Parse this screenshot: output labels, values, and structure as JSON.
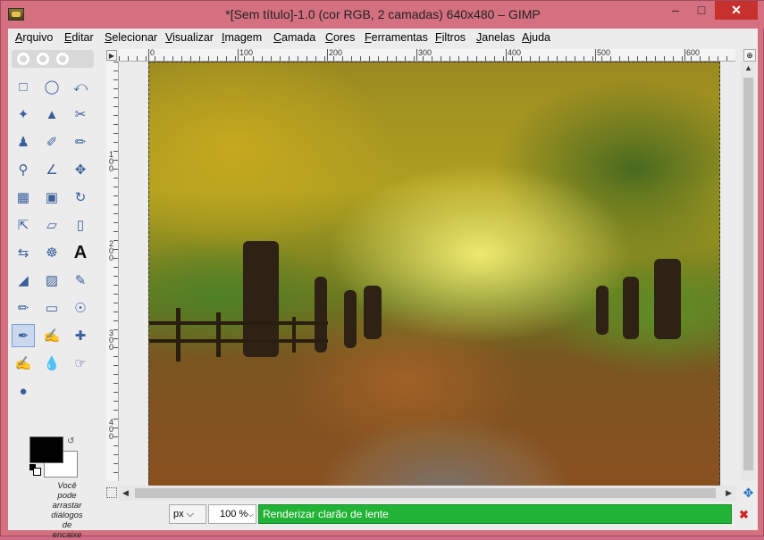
{
  "window": {
    "title": "*[Sem título]-1.0 (cor RGB, 2 camadas) 640x480 – GIMP"
  },
  "menu": [
    "Arquivo",
    "Editar",
    "Selecionar",
    "Visualizar",
    "Imagem",
    "Camada",
    "Cores",
    "Ferramentas",
    "Filtros",
    "Janelas",
    "Ajuda"
  ],
  "toolbox": {
    "tools": [
      "rect-select-icon",
      "ellipse-select-icon",
      "free-select-icon",
      "fuzzy-select-icon",
      "select-by-color-icon",
      "scissors-icon",
      "foreground-select-icon",
      "paths-icon",
      "color-picker-icon",
      "zoom-icon",
      "measure-icon",
      "move-icon",
      "align-icon",
      "crop-icon",
      "rotate-icon",
      "scale-icon",
      "shear-icon",
      "perspective-icon",
      "flip-icon",
      "cage-icon",
      "text-icon",
      "bucket-fill-icon",
      "blend-icon",
      "pencil-icon",
      "paintbrush-icon",
      "eraser-icon",
      "airbrush-icon",
      "ink-icon",
      "clone-icon",
      "heal-icon",
      "perspective-clone-icon",
      "blur-icon",
      "smudge-icon",
      "dodge-burn-icon"
    ],
    "dock_hint": "Você pode arrastar diálogos de encaixe"
  },
  "rulers": {
    "h_labels": [
      "0",
      "100",
      "200",
      "300",
      "400",
      "500",
      "600"
    ],
    "v_labels": [
      "1\n0\n0",
      "2\n0\n0",
      "3\n0\n0",
      "4\n0\n0"
    ]
  },
  "status": {
    "unit": "px",
    "zoom": "100 %",
    "progress_text": "Renderizar clarão de lente"
  },
  "colors": {
    "progress": "#21b335",
    "title_bar": "#d4707f",
    "close": "#c7312d"
  }
}
